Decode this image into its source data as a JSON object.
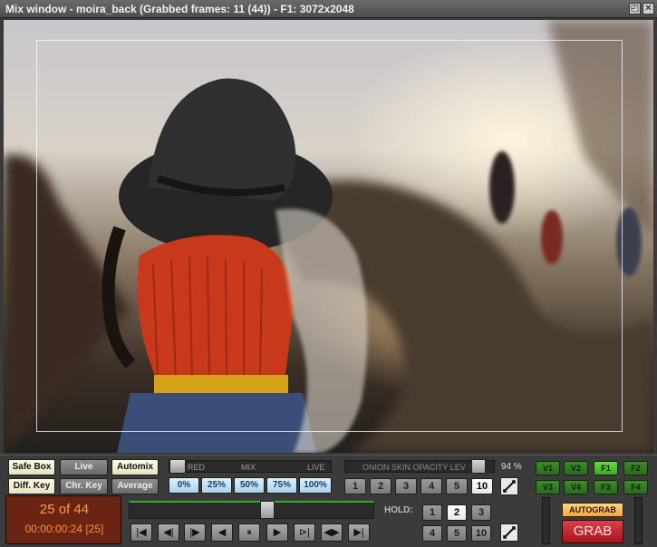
{
  "window": {
    "title": "Mix window - moira_back (Grabbed frames: 11 (44)) - F1: 3072x2048",
    "restore_glyph": "◰",
    "close_glyph": "✕"
  },
  "row1": {
    "safe_box": "Safe Box",
    "live": "Live",
    "automix": "Automix",
    "mix_labels": {
      "left": "RED",
      "mid": "MIX",
      "right": "LIVE"
    },
    "onion_label": "ONION SKIN OPACITY LEV",
    "opacity_percent": "94 %"
  },
  "row2": {
    "diff_key": "Diff. Key",
    "chr_key": "Chr. Key",
    "average": "Average",
    "mix_presets": [
      "0%",
      "25%",
      "50%",
      "75%",
      "100%"
    ],
    "onion_levels": [
      "1",
      "2",
      "3",
      "4",
      "5",
      "10"
    ]
  },
  "video_inputs": {
    "row1": [
      "V1",
      "V2",
      "F1",
      "F2"
    ],
    "row2": [
      "V3",
      "V4",
      "F3",
      "F4"
    ],
    "selected": [
      "F1"
    ]
  },
  "counter": {
    "frame": "25 of 44",
    "timecode": "00:00:00:24 [25]"
  },
  "transport": [
    "|◀",
    "◀|",
    "|▶",
    "◀",
    "⏸",
    "▶",
    "⊳|",
    "◀▶",
    "▶|"
  ],
  "hold": {
    "label": "HOLD:",
    "row1": [
      "1",
      "2",
      "3"
    ],
    "row2": [
      "4",
      "5",
      "10"
    ],
    "selected": "2"
  },
  "grab": {
    "autograb": "AUTOGRAB",
    "grab": "GRAB"
  },
  "colors": {
    "accent_green": "#4fbf35",
    "grab_red": "#c2222a",
    "counter_orange": "#ff9a3a"
  },
  "sliders": {
    "mix_position": 0.0,
    "onion_opacity": 0.94,
    "timeline_position": 0.57
  }
}
